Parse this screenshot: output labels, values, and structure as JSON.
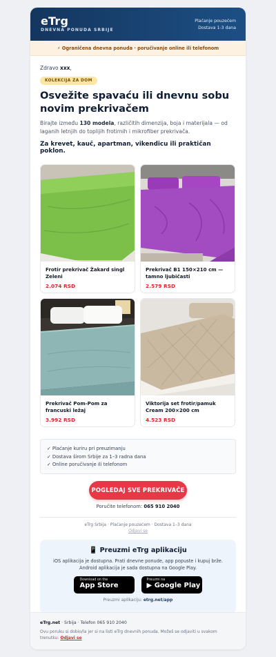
{
  "header": {
    "brand": "eTrg",
    "subtitle": "DNEVNA PONUDA SRBIJE",
    "right_line1": "Plaćanje pouzećem",
    "right_line2": "Dostava 1-3 dana"
  },
  "banner": "⚡ Ograničena dnevna ponuda · poručivanje online ili telefonom",
  "greeting": {
    "prefix": "Zdravo ",
    "name": "xxx",
    "suffix": ","
  },
  "badge": "KOLEKCIJA ZA DOM",
  "headline": "Osvežite spavaću ili dnevnu sobu novim prekrivačem",
  "description": {
    "before": "Birajte između ",
    "bold": "130 modela",
    "after": ", različitih dimenzija, boja i materijala — od laganih letnjih do toplijih frotirnih i mikrofiber prekrivača."
  },
  "tagline": "Za krevet, kauč, apartman, vikendicu ili praktičan poklon.",
  "products": [
    {
      "name": "Frotir prekrivač Žakard singl Zeleni",
      "price": "2.074 RSD"
    },
    {
      "name": "Prekrivač B1 150×210 cm — tamno ljubičasti",
      "price": "2.579 RSD"
    },
    {
      "name": "Prekrivač Pom-Pom za francuski ležaj",
      "price": "3.992 RSD"
    },
    {
      "name": "Viktorija set frotir/pamuk Cream 200×200 cm",
      "price": "4.523 RSD"
    }
  ],
  "checks": [
    "✓ Plaćanje kuriru pri preuzimanju",
    "✓ Dostava širom Srbije za 1–3 radna dana",
    "✓ Online poručivanje ili telefonom"
  ],
  "cta": "POGLEDAJ SVE PREKRIVAČE",
  "phone": {
    "label": "Poručite telefonom: ",
    "number": "065 910 2040"
  },
  "footmeta": "eTrg Srbija · Plaćanje pouzećem · Dostava 1–3 dana",
  "unsubscribe_short": "Odjavi se",
  "app": {
    "title": "📱 Preuzmi eTrg aplikaciju",
    "line1": "iOS aplikacija je dostupna. Prati dnevne ponude, app popuste i kupuj brže.",
    "line2": "Android aplikacija je sada dostupna na Google Play.",
    "appstore_small": "Download on the",
    "appstore_big": " App Store",
    "gplay_small": "Preuzmi na",
    "gplay_big": "▶ Google Play",
    "link_label": "Preuzmi aplikaciju: ",
    "link": "etrg.net/app"
  },
  "footer": {
    "site": "eTrg.net",
    "rest": " · Srbija · Telefon 065 910 2040",
    "notice": "Ovu poruku si dobio/la jer si na listi eTrg dnevnih ponuda. Možeš se odjaviti u svakom trenutku: ",
    "unsub": "Odjavi se"
  },
  "colors": {
    "brand_dark": "#14365e",
    "accent_red": "#e63947",
    "price_red": "#dc2626",
    "banner_bg": "#fdf1e2"
  }
}
